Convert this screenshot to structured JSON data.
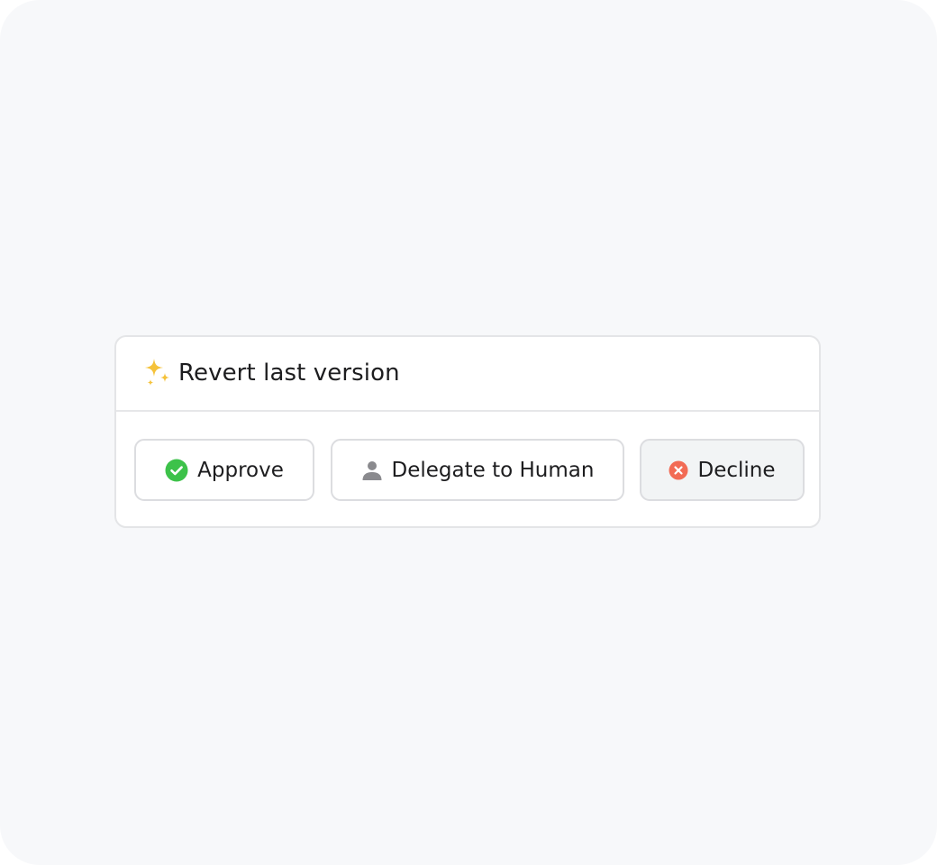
{
  "action": {
    "title": "Revert last version",
    "title_icon": "sparkles-icon"
  },
  "buttons": {
    "approve": {
      "label": "Approve",
      "icon": "check-circle-icon",
      "color": "#3dc24a"
    },
    "delegate": {
      "label": "Delegate to Human",
      "icon": "person-icon",
      "color": "#8a8a8e"
    },
    "decline": {
      "label": "Decline",
      "icon": "x-circle-icon",
      "color": "#f26b55"
    }
  },
  "colors": {
    "background": "#f7f8fa",
    "card": "#ffffff",
    "border": "#e4e5e7",
    "sparkle": "#f5c23a",
    "decline_bg": "#f2f4f5"
  }
}
